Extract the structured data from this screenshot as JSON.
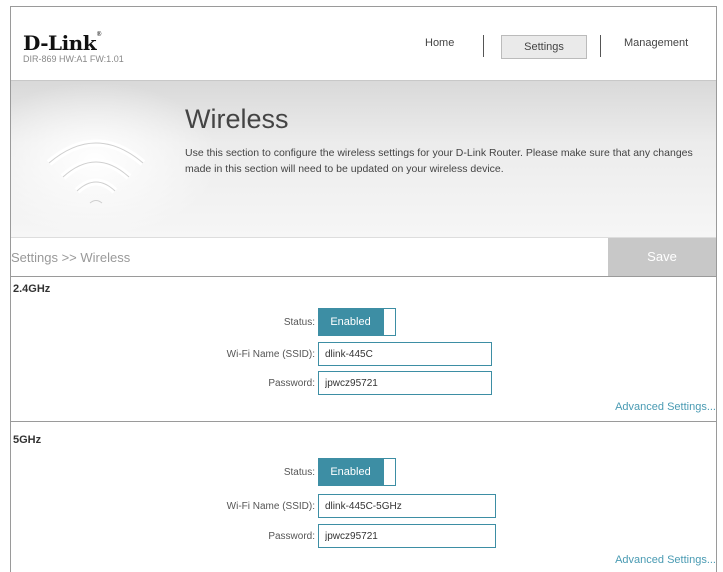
{
  "header": {
    "logo": "D-Link",
    "logo_mark": "®",
    "model": "DIR-869 HW:A1 FW:1.01",
    "nav": {
      "home": "Home",
      "settings": "Settings",
      "management": "Management"
    }
  },
  "banner": {
    "title": "Wireless",
    "description": "Use this section to configure the wireless settings for your D-Link Router. Please make sure that any changes made in this section will need to be updated on your wireless device.",
    "icon": "wifi-icon"
  },
  "breadcrumb": "Settings >> Wireless",
  "save_label": "Save",
  "bands": [
    {
      "title": "2.4GHz",
      "status_label": "Status:",
      "status_value": "Enabled",
      "ssid_label": "Wi-Fi Name (SSID):",
      "ssid_value": "dlink-445C",
      "password_label": "Password:",
      "password_value": "jpwcz95721",
      "advanced": "Advanced Settings..."
    },
    {
      "title": "5GHz",
      "status_label": "Status:",
      "status_value": "Enabled",
      "ssid_label": "Wi-Fi Name (SSID):",
      "ssid_value": "dlink-445C-5GHz",
      "password_label": "Password:",
      "password_value": "jpwcz95721",
      "advanced": "Advanced Settings..."
    }
  ],
  "colors": {
    "accent": "#3d8ea4",
    "link": "#4a9bb3",
    "save_bg": "#c8c8c8"
  }
}
